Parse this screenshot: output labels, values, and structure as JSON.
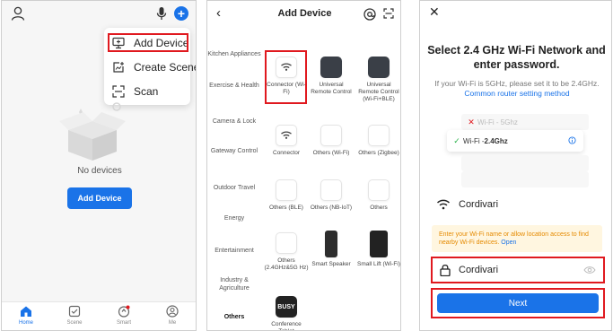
{
  "colors": {
    "accent": "#1a73e8",
    "highlight": "#e0191f",
    "warning_text": "#e58a00",
    "warning_bg": "#fff6e0"
  },
  "panel1": {
    "icons": [
      "user-icon",
      "microphone-icon",
      "plus-circle-icon"
    ],
    "menu": [
      {
        "icon": "add-device-icon",
        "label": "Add Device"
      },
      {
        "icon": "create-scene-icon",
        "label": "Create Scene"
      },
      {
        "icon": "scan-icon",
        "label": "Scan"
      }
    ],
    "empty_text": "No devices",
    "add_button": "Add Device",
    "tabs": [
      {
        "label": "Home",
        "icon": "home-icon",
        "active": true
      },
      {
        "label": "Scene",
        "icon": "scene-icon",
        "active": false
      },
      {
        "label": "Smart",
        "icon": "smart-icon",
        "active": false
      },
      {
        "label": "Me",
        "icon": "me-icon",
        "active": false
      }
    ]
  },
  "panel2": {
    "title": "Add Device",
    "categories": [
      "Kitchen Appliances",
      "Exercise & Health",
      "Camera & Lock",
      "Gateway Control",
      "Outdoor Travel",
      "Energy",
      "Entertainment",
      "Industry & Agriculture",
      "Others"
    ],
    "active_category": "Others",
    "devices": [
      {
        "label": "Connector (Wi-Fi)",
        "icon": "wifi-icon"
      },
      {
        "label": "Universal Remote Control",
        "icon": "remote-icon"
      },
      {
        "label": "Universal Remote Control (Wi-Fi+BLE)",
        "icon": "remote-icon"
      },
      {
        "label": "Connector",
        "icon": "wifi-icon"
      },
      {
        "label": "Others (Wi-Fi)",
        "icon": "blank-tile-icon"
      },
      {
        "label": "Others (Zigbee)",
        "icon": "blank-tile-icon"
      },
      {
        "label": "Others (BLE)",
        "icon": "blank-tile-icon"
      },
      {
        "label": "Others (NB-IoT)",
        "icon": "blank-tile-icon"
      },
      {
        "label": "Others",
        "icon": "blank-tile-icon"
      },
      {
        "label": "Others (2.4GHz&5G Hz)",
        "icon": "blank-tile-icon"
      },
      {
        "label": "Smart Speaker",
        "icon": "speaker-icon"
      },
      {
        "label": "Small Lift (Wi-Fi)",
        "icon": "lift-icon"
      },
      {
        "label": "Conference Tablet",
        "icon": "busy-tablet-icon",
        "tile_text": "BUSY"
      }
    ]
  },
  "panel3": {
    "title": "Select 2.4 GHz Wi-Fi Network and enter password.",
    "subtitle": "If your Wi-Fi is 5GHz, please set it to be 2.4GHz.",
    "subtitle_link": "Common router setting method",
    "illus": {
      "row_5g": "Wi-Fi - 5Ghz",
      "row_24_prefix": "Wi-Fi - ",
      "row_24_bold": "2.4Ghz"
    },
    "ssid": "Cordivari",
    "warning": "Enter your Wi-Fi name or allow location access to find nearby Wi-Fi devices.",
    "warning_link": "Open",
    "password": "Cordivari",
    "next": "Next"
  }
}
